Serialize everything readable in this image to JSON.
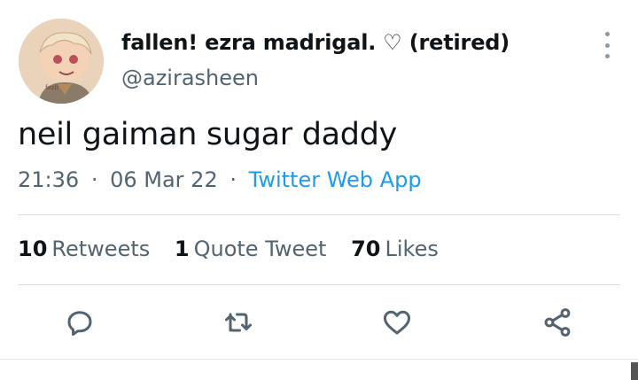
{
  "tweet": {
    "display_name": "fallen! ezra madrigal. ♡ (retired)",
    "handle": "@azirasheen",
    "text": "neil gaiman sugar daddy",
    "time": "21:36",
    "date": "06 Mar 22",
    "source": "Twitter Web App",
    "separator": "·"
  },
  "stats": {
    "retweets_count": "10",
    "retweets_label": "Retweets",
    "quotes_count": "1",
    "quotes_label": "Quote Tweet",
    "likes_count": "70",
    "likes_label": "Likes"
  },
  "icons": {
    "avatar": "illustrated-avatar",
    "more": "more-vertical-icon",
    "reply": "reply-icon",
    "retweet": "retweet-icon",
    "like": "heart-icon",
    "share": "share-icon"
  },
  "colors": {
    "text": "#0f1419",
    "secondary": "#536471",
    "link": "#1d9bf0",
    "divider": "#dcdfe2"
  }
}
